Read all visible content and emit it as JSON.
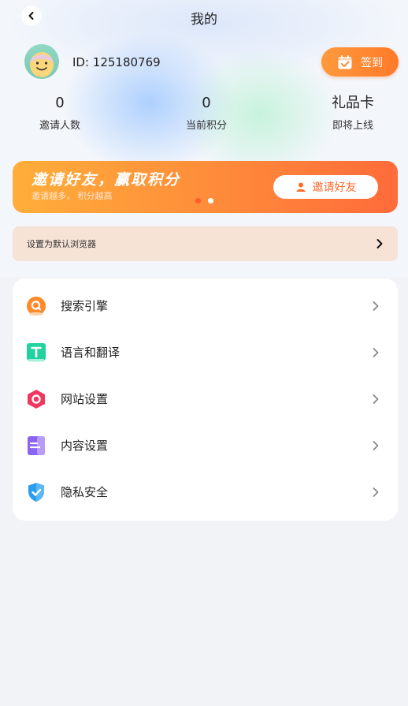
{
  "header": {
    "title": "我的"
  },
  "profile": {
    "id_text": "ID: 125180769"
  },
  "checkin": {
    "label": "签到"
  },
  "stats": [
    {
      "value": "0",
      "label": "邀请人数"
    },
    {
      "value": "0",
      "label": "当前积分"
    },
    {
      "value": "礼品卡",
      "label": "即将上线"
    }
  ],
  "banner": {
    "title": "邀请好友，赢取积分",
    "subtitle": "邀请越多， 积分越高",
    "button_label": "邀请好友",
    "page_count": 2,
    "active_page": 2
  },
  "default_browser": {
    "label": "设置为默认浏览器"
  },
  "menu": [
    {
      "label": "搜索引擎",
      "icon": "search-engine-icon"
    },
    {
      "label": "语言和翻译",
      "icon": "translate-icon"
    },
    {
      "label": "网站设置",
      "icon": "website-settings-icon"
    },
    {
      "label": "内容设置",
      "icon": "content-settings-icon"
    },
    {
      "label": "隐私安全",
      "icon": "privacy-shield-icon"
    }
  ],
  "colors": {
    "accent_orange": "#ff7a2a",
    "banner_start": "#ffae3a",
    "banner_end": "#ff6b3a",
    "default_bar_bg": "#f7e2d6",
    "page_bg": "#f2f3f7"
  }
}
